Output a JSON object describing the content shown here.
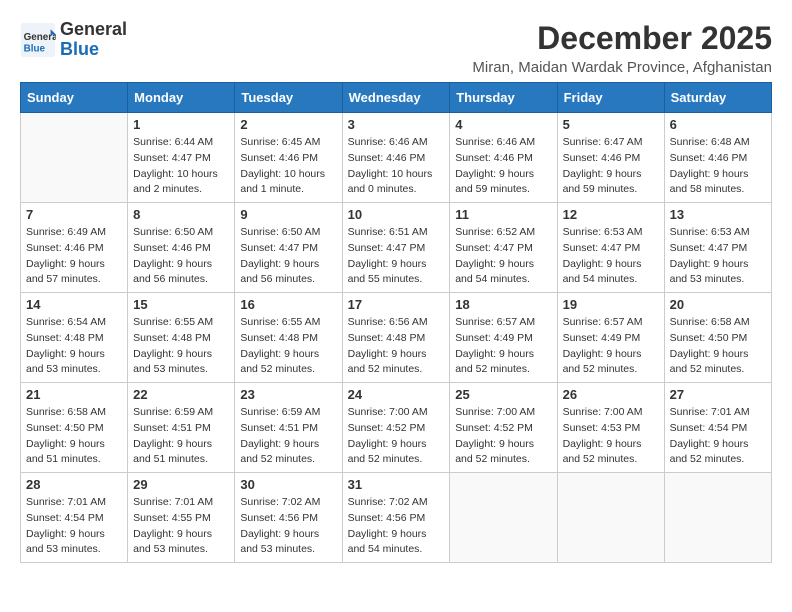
{
  "logo": {
    "general": "General",
    "blue": "Blue"
  },
  "title": "December 2025",
  "subtitle": "Miran, Maidan Wardak Province, Afghanistan",
  "days_of_week": [
    "Sunday",
    "Monday",
    "Tuesday",
    "Wednesday",
    "Thursday",
    "Friday",
    "Saturday"
  ],
  "weeks": [
    [
      {
        "day": "",
        "info": ""
      },
      {
        "day": "1",
        "info": "Sunrise: 6:44 AM\nSunset: 4:47 PM\nDaylight: 10 hours\nand 2 minutes."
      },
      {
        "day": "2",
        "info": "Sunrise: 6:45 AM\nSunset: 4:46 PM\nDaylight: 10 hours\nand 1 minute."
      },
      {
        "day": "3",
        "info": "Sunrise: 6:46 AM\nSunset: 4:46 PM\nDaylight: 10 hours\nand 0 minutes."
      },
      {
        "day": "4",
        "info": "Sunrise: 6:46 AM\nSunset: 4:46 PM\nDaylight: 9 hours\nand 59 minutes."
      },
      {
        "day": "5",
        "info": "Sunrise: 6:47 AM\nSunset: 4:46 PM\nDaylight: 9 hours\nand 59 minutes."
      },
      {
        "day": "6",
        "info": "Sunrise: 6:48 AM\nSunset: 4:46 PM\nDaylight: 9 hours\nand 58 minutes."
      }
    ],
    [
      {
        "day": "7",
        "info": "Sunrise: 6:49 AM\nSunset: 4:46 PM\nDaylight: 9 hours\nand 57 minutes."
      },
      {
        "day": "8",
        "info": "Sunrise: 6:50 AM\nSunset: 4:46 PM\nDaylight: 9 hours\nand 56 minutes."
      },
      {
        "day": "9",
        "info": "Sunrise: 6:50 AM\nSunset: 4:47 PM\nDaylight: 9 hours\nand 56 minutes."
      },
      {
        "day": "10",
        "info": "Sunrise: 6:51 AM\nSunset: 4:47 PM\nDaylight: 9 hours\nand 55 minutes."
      },
      {
        "day": "11",
        "info": "Sunrise: 6:52 AM\nSunset: 4:47 PM\nDaylight: 9 hours\nand 54 minutes."
      },
      {
        "day": "12",
        "info": "Sunrise: 6:53 AM\nSunset: 4:47 PM\nDaylight: 9 hours\nand 54 minutes."
      },
      {
        "day": "13",
        "info": "Sunrise: 6:53 AM\nSunset: 4:47 PM\nDaylight: 9 hours\nand 53 minutes."
      }
    ],
    [
      {
        "day": "14",
        "info": "Sunrise: 6:54 AM\nSunset: 4:48 PM\nDaylight: 9 hours\nand 53 minutes."
      },
      {
        "day": "15",
        "info": "Sunrise: 6:55 AM\nSunset: 4:48 PM\nDaylight: 9 hours\nand 53 minutes."
      },
      {
        "day": "16",
        "info": "Sunrise: 6:55 AM\nSunset: 4:48 PM\nDaylight: 9 hours\nand 52 minutes."
      },
      {
        "day": "17",
        "info": "Sunrise: 6:56 AM\nSunset: 4:48 PM\nDaylight: 9 hours\nand 52 minutes."
      },
      {
        "day": "18",
        "info": "Sunrise: 6:57 AM\nSunset: 4:49 PM\nDaylight: 9 hours\nand 52 minutes."
      },
      {
        "day": "19",
        "info": "Sunrise: 6:57 AM\nSunset: 4:49 PM\nDaylight: 9 hours\nand 52 minutes."
      },
      {
        "day": "20",
        "info": "Sunrise: 6:58 AM\nSunset: 4:50 PM\nDaylight: 9 hours\nand 52 minutes."
      }
    ],
    [
      {
        "day": "21",
        "info": "Sunrise: 6:58 AM\nSunset: 4:50 PM\nDaylight: 9 hours\nand 51 minutes."
      },
      {
        "day": "22",
        "info": "Sunrise: 6:59 AM\nSunset: 4:51 PM\nDaylight: 9 hours\nand 51 minutes."
      },
      {
        "day": "23",
        "info": "Sunrise: 6:59 AM\nSunset: 4:51 PM\nDaylight: 9 hours\nand 52 minutes."
      },
      {
        "day": "24",
        "info": "Sunrise: 7:00 AM\nSunset: 4:52 PM\nDaylight: 9 hours\nand 52 minutes."
      },
      {
        "day": "25",
        "info": "Sunrise: 7:00 AM\nSunset: 4:52 PM\nDaylight: 9 hours\nand 52 minutes."
      },
      {
        "day": "26",
        "info": "Sunrise: 7:00 AM\nSunset: 4:53 PM\nDaylight: 9 hours\nand 52 minutes."
      },
      {
        "day": "27",
        "info": "Sunrise: 7:01 AM\nSunset: 4:54 PM\nDaylight: 9 hours\nand 52 minutes."
      }
    ],
    [
      {
        "day": "28",
        "info": "Sunrise: 7:01 AM\nSunset: 4:54 PM\nDaylight: 9 hours\nand 53 minutes."
      },
      {
        "day": "29",
        "info": "Sunrise: 7:01 AM\nSunset: 4:55 PM\nDaylight: 9 hours\nand 53 minutes."
      },
      {
        "day": "30",
        "info": "Sunrise: 7:02 AM\nSunset: 4:56 PM\nDaylight: 9 hours\nand 53 minutes."
      },
      {
        "day": "31",
        "info": "Sunrise: 7:02 AM\nSunset: 4:56 PM\nDaylight: 9 hours\nand 54 minutes."
      },
      {
        "day": "",
        "info": ""
      },
      {
        "day": "",
        "info": ""
      },
      {
        "day": "",
        "info": ""
      }
    ]
  ]
}
